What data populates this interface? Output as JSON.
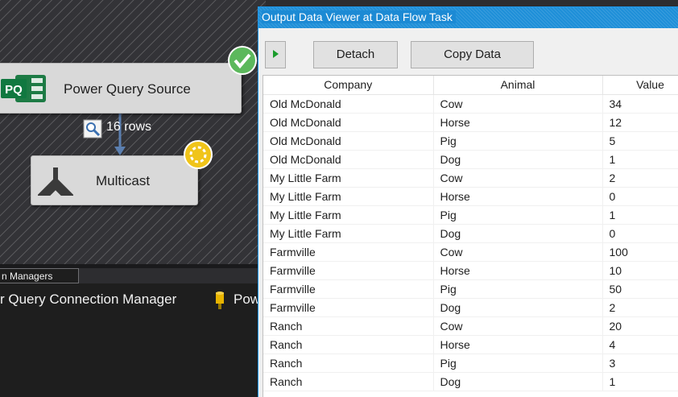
{
  "designer": {
    "power_query_source_label": "Power Query Source",
    "pq_logo_text": "PQ",
    "multicast_label": "Multicast",
    "rows_label": "16 rows"
  },
  "connection_managers": {
    "tab_label": "n Managers",
    "item1_label": "r Query Connection Manager",
    "item2_label": "Pow"
  },
  "viewer": {
    "title": "Output Data Viewer at Data Flow Task",
    "detach_label": "Detach",
    "copy_label": "Copy Data",
    "columns": [
      "Company",
      "Animal",
      "Value"
    ],
    "rows": [
      [
        "Old McDonald",
        "Cow",
        "34"
      ],
      [
        "Old McDonald",
        "Horse",
        "12"
      ],
      [
        "Old McDonald",
        "Pig",
        "5"
      ],
      [
        "Old McDonald",
        "Dog",
        "1"
      ],
      [
        "My Little Farm",
        "Cow",
        "2"
      ],
      [
        "My Little Farm",
        "Horse",
        "0"
      ],
      [
        "My Little Farm",
        "Pig",
        "1"
      ],
      [
        "My Little Farm",
        "Dog",
        "0"
      ],
      [
        "Farmville",
        "Cow",
        "100"
      ],
      [
        "Farmville",
        "Horse",
        "10"
      ],
      [
        "Farmville",
        "Pig",
        "50"
      ],
      [
        "Farmville",
        "Dog",
        "2"
      ],
      [
        "Ranch",
        "Cow",
        "20"
      ],
      [
        "Ranch",
        "Horse",
        "4"
      ],
      [
        "Ranch",
        "Pig",
        "3"
      ],
      [
        "Ranch",
        "Dog",
        "1"
      ]
    ]
  },
  "colors": {
    "accent_blue": "#1e8fd8",
    "success_green": "#1a9c2b"
  }
}
